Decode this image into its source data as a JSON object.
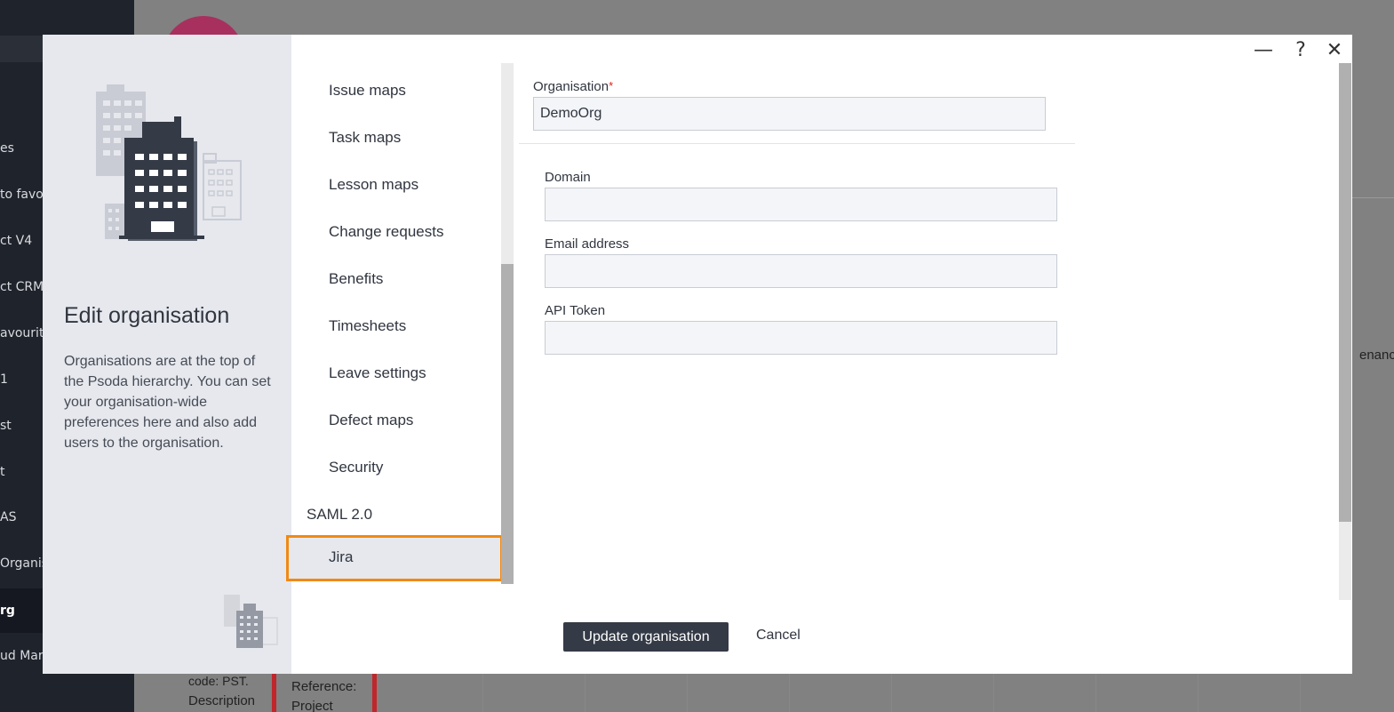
{
  "background": {
    "sidebar_items": [
      "es",
      "to favou",
      "ct V4",
      "ct CRM",
      "avourite",
      "1",
      "st",
      "t",
      "AS",
      "Organis",
      "rg",
      "ud Mark"
    ],
    "right_text": "enance",
    "cell_texts": [
      "code: PST.",
      "Description",
      "Reference:",
      "Project"
    ]
  },
  "modal": {
    "title": "Edit organisation",
    "description": "Organisations are at the top of the Psoda hierarchy. You can set your organisation-wide preferences here and also add users to the organisation.",
    "window_controls": {
      "minimize": "—",
      "help": "?",
      "close": "✕"
    },
    "menu": {
      "items": [
        "Issue maps",
        "Task maps",
        "Lesson maps",
        "Change requests",
        "Benefits",
        "Timesheets",
        "Leave settings",
        "Defect maps",
        "Security"
      ],
      "section_heading": "SAML 2.0",
      "active_item": "Jira"
    },
    "form": {
      "organisation_label": "Organisation",
      "organisation_required": "*",
      "organisation_value": "DemoOrg",
      "domain_label": "Domain",
      "domain_value": "",
      "email_label": "Email address",
      "email_value": "",
      "token_label": "API Token",
      "token_value": ""
    },
    "actions": {
      "update": "Update organisation",
      "cancel": "Cancel"
    }
  },
  "colors": {
    "accent_highlight": "#f08a14",
    "primary_button": "#343a46",
    "required": "#e02020"
  },
  "icons": [
    "buildings-illustration",
    "small-buildings-illustration",
    "minimize-icon",
    "help-icon",
    "close-icon"
  ]
}
